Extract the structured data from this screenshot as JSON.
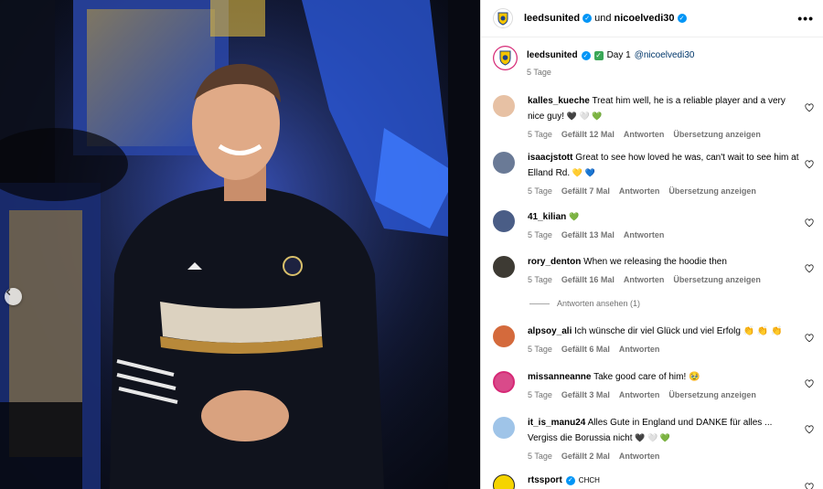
{
  "header": {
    "account1": "leedsunited",
    "connector": "und",
    "account2": "nicoelvedi30",
    "more_label": "•••"
  },
  "caption": {
    "username": "leedsunited",
    "text": "Day 1",
    "mention": "@nicoelvedi30",
    "time": "5 Tage"
  },
  "comments": [
    {
      "user": "kalles_kueche",
      "text": "Treat him well, he is a reliable player and a very nice guy!",
      "emoji": [
        "🖤",
        "🤍",
        "💚"
      ],
      "time": "5 Tage",
      "likes": "Gefällt 12 Mal",
      "reply": "Antworten",
      "translate": "Übersetzung anzeigen"
    },
    {
      "user": "isaacjstott",
      "text": "Great to see how loved he was, can't wait to see him at Elland Rd.",
      "emoji": [
        "💛",
        "💙"
      ],
      "time": "5 Tage",
      "likes": "Gefällt 7 Mal",
      "reply": "Antworten",
      "translate": "Übersetzung anzeigen"
    },
    {
      "user": "41_kilian",
      "text": "",
      "emoji": [
        "💚"
      ],
      "time": "5 Tage",
      "likes": "Gefällt 13 Mal",
      "reply": "Antworten",
      "translate": ""
    },
    {
      "user": "rory_denton",
      "text": "When we releasing the hoodie then",
      "emoji": [],
      "time": "5 Tage",
      "likes": "Gefällt 16 Mal",
      "reply": "Antworten",
      "translate": "Übersetzung anzeigen"
    },
    {
      "user": "alpsoy_ali",
      "text": "Ich wünsche dir viel Glück und viel Erfolg",
      "emoji": [
        "👏",
        "👏",
        "👏"
      ],
      "time": "5 Tage",
      "likes": "Gefällt 6 Mal",
      "reply": "Antworten",
      "translate": ""
    },
    {
      "user": "missanneanne",
      "text": "Take good care of him!",
      "emoji": [
        "🥹"
      ],
      "time": "5 Tage",
      "likes": "Gefällt 3 Mal",
      "reply": "Antworten",
      "translate": "Übersetzung anzeigen"
    },
    {
      "user": "it_is_manu24",
      "text": "Alles Gute in England und DANKE für alles ... Vergiss die Borussia nicht",
      "emoji": [
        "🖤",
        "🤍",
        "💚"
      ],
      "time": "5 Tage",
      "likes": "Gefällt 2 Mal",
      "reply": "Antworten",
      "translate": ""
    },
    {
      "user": "rtssport",
      "text": "CHCH",
      "emoji": [],
      "time": "",
      "likes": "",
      "reply": "",
      "translate": ""
    }
  ],
  "view_replies": "Antworten ansehen (1)",
  "colors": {
    "accent": "#0095f6",
    "secondary_text": "#737373",
    "link": "#00376b"
  }
}
